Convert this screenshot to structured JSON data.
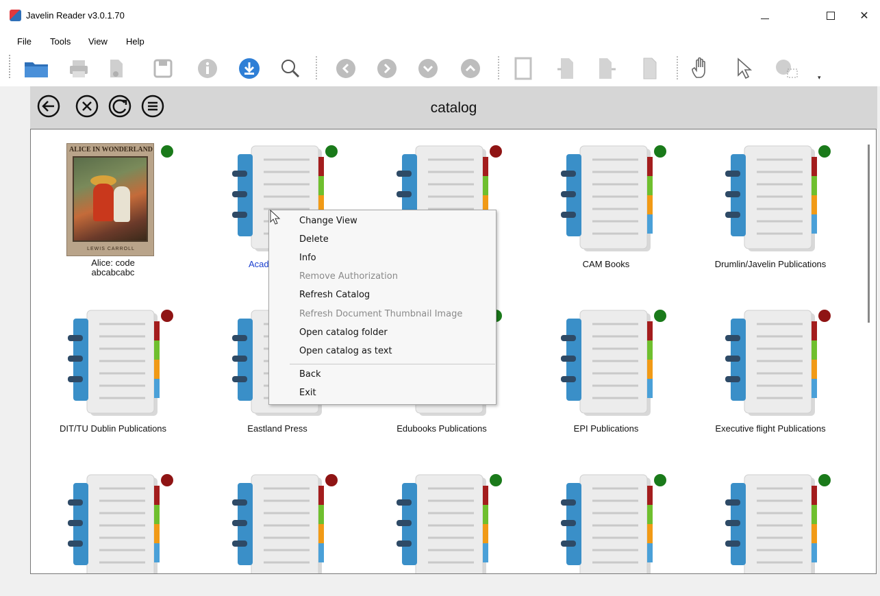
{
  "window": {
    "title": "Javelin Reader v3.0.1.70"
  },
  "menu": [
    "File",
    "Tools",
    "View",
    "Help"
  ],
  "toolbar": {
    "buttons": [
      "open-folder-icon",
      "print-icon",
      "cut-page-icon",
      "save-icon",
      "info-icon",
      "download-icon",
      "search-icon",
      "first-page-icon",
      "next-page-icon",
      "down-icon",
      "up-icon",
      "page-fit-icon",
      "rotate-left-icon",
      "rotate-right-icon",
      "page-width-icon",
      "hand-tool-icon",
      "select-tool-icon",
      "zoom-tool-icon"
    ],
    "overflow_glyph": "▾"
  },
  "catalog": {
    "title": "catalog",
    "nav_icons": [
      "back-icon",
      "close-icon",
      "refresh-icon",
      "menu-icon"
    ]
  },
  "tiles": [
    {
      "label": "Alice: code\nabcabcabc",
      "status": "green",
      "type": "book",
      "cover_title": "ALICE IN WONDERLAND",
      "cover_author": "LEWIS CARROLL"
    },
    {
      "label": "Acad",
      "status": "green",
      "type": "catalog",
      "link": true
    },
    {
      "label": "",
      "status": "red",
      "type": "catalog"
    },
    {
      "label": "CAM Books",
      "status": "green",
      "type": "catalog"
    },
    {
      "label": "Drumlin/Javelin Publications",
      "status": "green",
      "type": "catalog"
    },
    {
      "label": "DIT/TU Dublin Publications",
      "status": "red",
      "type": "catalog"
    },
    {
      "label": "Eastland Press",
      "status": "",
      "type": "catalog"
    },
    {
      "label": "Edubooks Publications",
      "status": "green",
      "type": "catalog"
    },
    {
      "label": "EPI Publications",
      "status": "green",
      "type": "catalog"
    },
    {
      "label": "Executive flight Publications",
      "status": "red",
      "type": "catalog"
    },
    {
      "label": "",
      "status": "red",
      "type": "catalog"
    },
    {
      "label": "",
      "status": "red",
      "type": "catalog"
    },
    {
      "label": "",
      "status": "green",
      "type": "catalog"
    },
    {
      "label": "",
      "status": "green",
      "type": "catalog"
    },
    {
      "label": "",
      "status": "green",
      "type": "catalog"
    }
  ],
  "context_menu": {
    "items": [
      {
        "label": "Change View",
        "enabled": true
      },
      {
        "label": "Delete",
        "enabled": true
      },
      {
        "label": "Info",
        "enabled": true
      },
      {
        "label": "Remove Authorization",
        "enabled": false
      },
      {
        "label": "Refresh Catalog",
        "enabled": true
      },
      {
        "label": "Refresh Document Thumbnail Image",
        "enabled": false
      },
      {
        "label": "Open catalog folder",
        "enabled": true
      },
      {
        "label": "Open catalog as text",
        "enabled": true
      },
      {
        "label": "Back",
        "enabled": true
      },
      {
        "label": "Exit",
        "enabled": true
      }
    ]
  },
  "colors": {
    "status_green": "#1a7a1a",
    "status_red": "#8f1414",
    "link": "#1a3ecf",
    "binder_blue": "#3a8fc8"
  }
}
